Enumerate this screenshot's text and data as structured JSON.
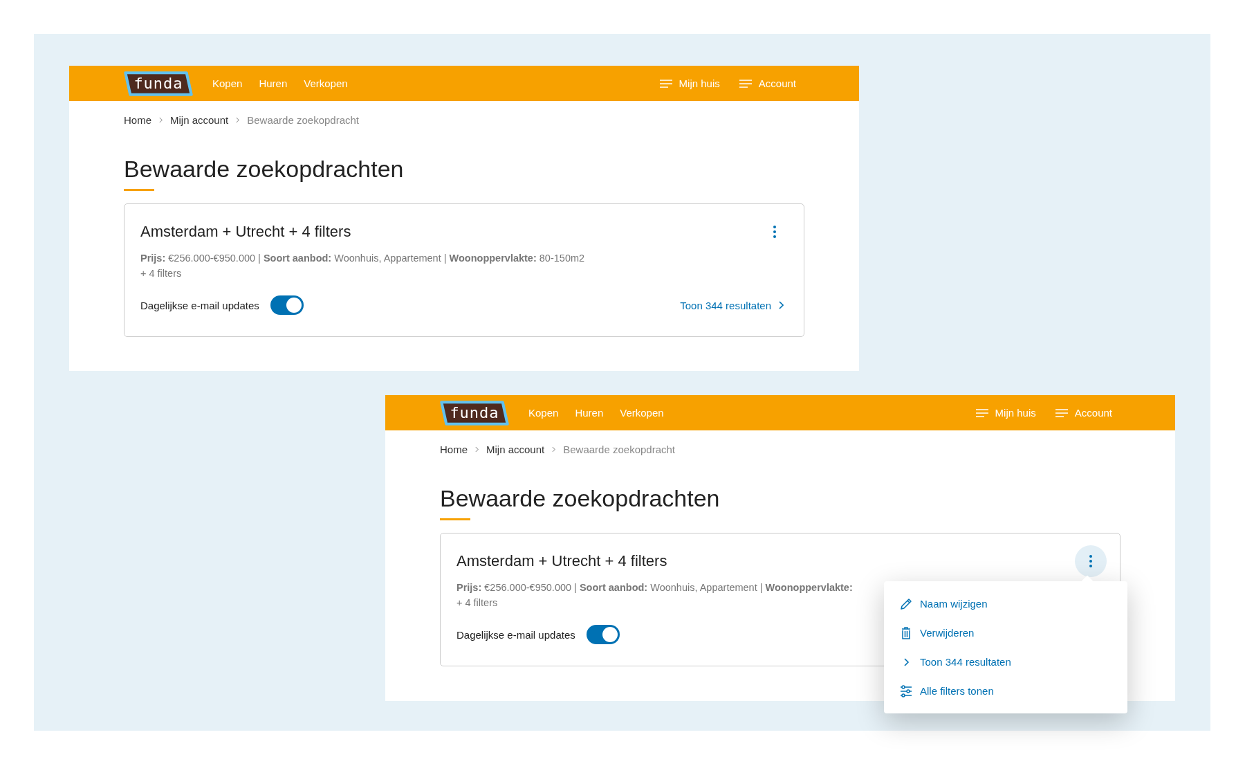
{
  "screens": [
    {
      "logo": "funda",
      "nav": [
        "Kopen",
        "Huren",
        "Verkopen"
      ],
      "nav_right": [
        "Mijn huis",
        "Account"
      ],
      "breadcrumb": [
        "Home",
        "Mijn account",
        "Bewaarde zoekopdracht"
      ],
      "title": "Bewaarde zoekopdrachten",
      "card": {
        "title": "Amsterdam + Utrecht + 4 filters",
        "filters": "**Prijs:** €256.000-€950.000 | **Soort aanbod:** Woonhuis, Appartement | **Woonoppervlakte:** 80-150m2",
        "more_filters": "+ 4 filters",
        "email_label": "Dagelijkse e-mail updates",
        "email_updates": true,
        "results_link": "Toon 344 resultaten"
      },
      "menu_open": false
    },
    {
      "logo": "funda",
      "nav": [
        "Kopen",
        "Huren",
        "Verkopen"
      ],
      "nav_right": [
        "Mijn huis",
        "Account"
      ],
      "breadcrumb": [
        "Home",
        "Mijn account",
        "Bewaarde zoekopdracht"
      ],
      "title": "Bewaarde zoekopdrachten",
      "card": {
        "title": "Amsterdam + Utrecht + 4 filters",
        "filters": "**Prijs:** €256.000-€950.000 | **Soort aanbod:** Woonhuis, Appartement | **Woonoppervlakte:**",
        "more_filters": "+ 4 filters",
        "email_label": "Dagelijkse e-mail updates",
        "email_updates": true
      },
      "menu_open": true,
      "menu": [
        {
          "kind": "edit",
          "label": "Naam wijzigen"
        },
        {
          "kind": "delete",
          "label": "Verwijderen"
        },
        {
          "kind": "show",
          "label": "Toon 344 resultaten"
        },
        {
          "kind": "filters",
          "label": "Alle filters tonen"
        }
      ]
    }
  ]
}
